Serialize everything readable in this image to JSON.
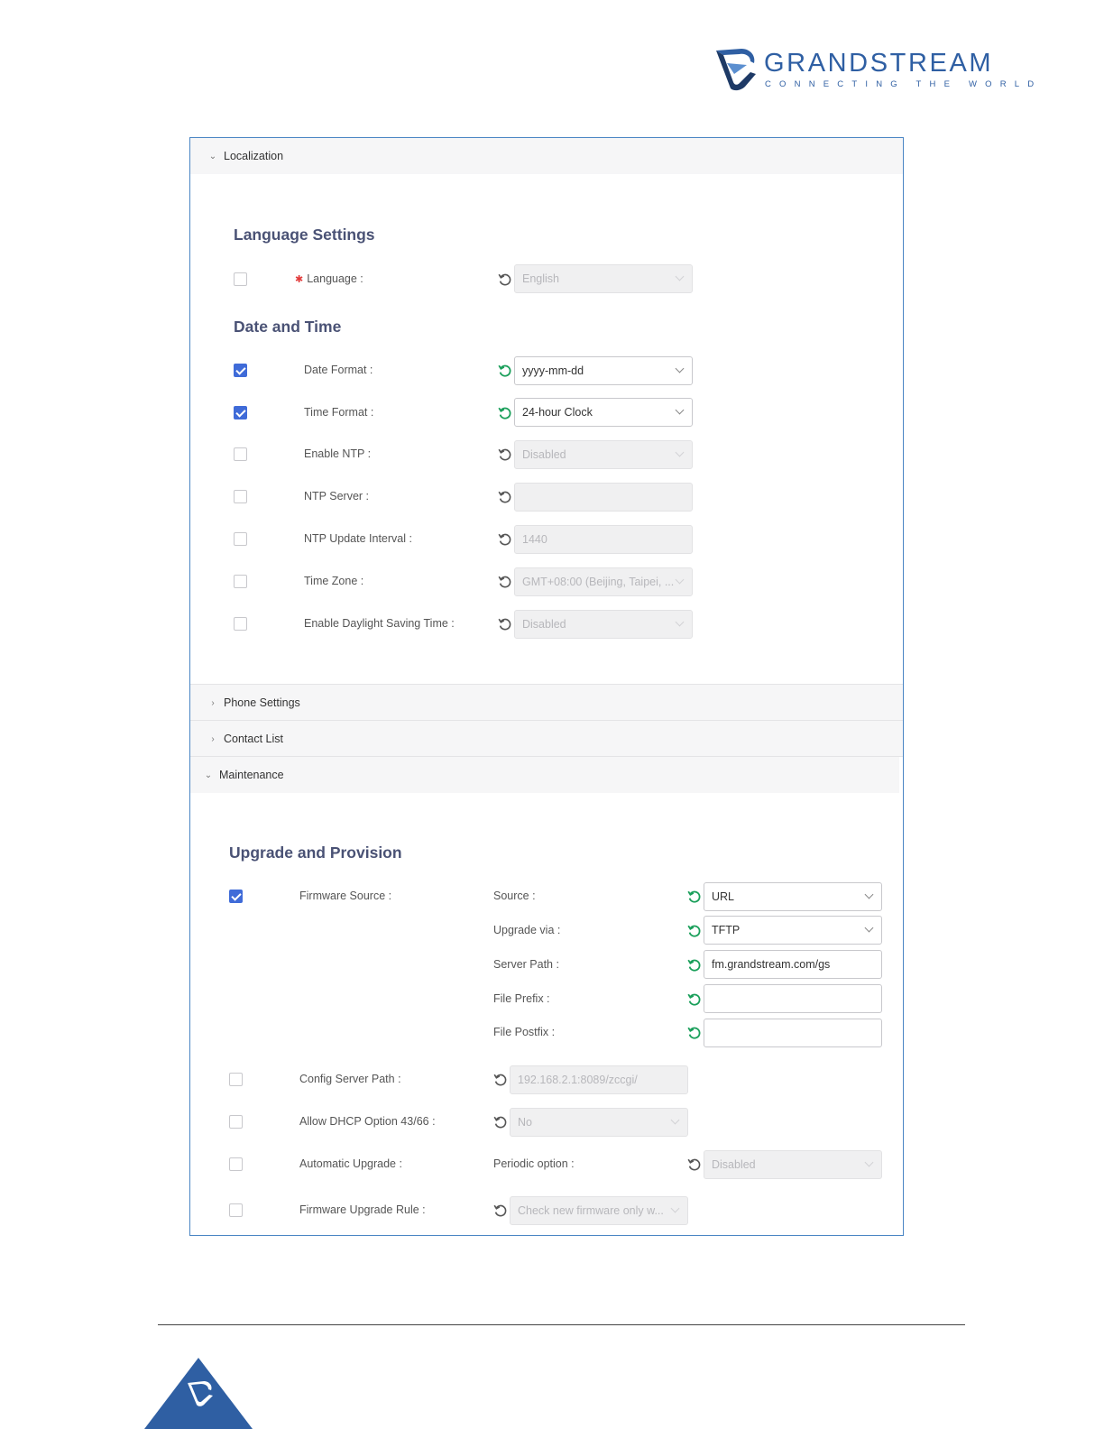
{
  "brand": {
    "name": "GRANDSTREAM",
    "tagline": "CONNECTING THE WORLD",
    "colors": {
      "primary": "#2f5fa3",
      "accent": "#3f6bd8",
      "reset_active": "#1a9f5a"
    }
  },
  "sections": {
    "localization": {
      "label": "Localization",
      "expanded": true
    },
    "phone_settings": {
      "label": "Phone Settings",
      "expanded": false
    },
    "contact_list": {
      "label": "Contact List",
      "expanded": false
    },
    "maintenance": {
      "label": "Maintenance",
      "expanded": true
    }
  },
  "language_settings": {
    "title": "Language Settings",
    "language": {
      "label": "Language :",
      "required": true,
      "checked": false,
      "value": "English"
    }
  },
  "date_time": {
    "title": "Date and Time",
    "date_format": {
      "label": "Date Format :",
      "checked": true,
      "value": "yyyy-mm-dd"
    },
    "time_format": {
      "label": "Time Format :",
      "checked": true,
      "value": "24-hour Clock"
    },
    "enable_ntp": {
      "label": "Enable NTP :",
      "checked": false,
      "value": "Disabled"
    },
    "ntp_server": {
      "label": "NTP Server :",
      "checked": false,
      "value": ""
    },
    "ntp_interval": {
      "label": "NTP Update Interval :",
      "checked": false,
      "value": "1440"
    },
    "time_zone": {
      "label": "Time Zone :",
      "checked": false,
      "value": "GMT+08:00 (Beijing, Taipei, ..."
    },
    "dst": {
      "label": "Enable Daylight Saving Time :",
      "checked": false,
      "value": "Disabled"
    }
  },
  "upgrade": {
    "title": "Upgrade and Provision",
    "firmware_source": {
      "label": "Firmware Source :",
      "checked": true,
      "source": {
        "label": "Source :",
        "value": "URL"
      },
      "upgrade_via": {
        "label": "Upgrade via :",
        "value": "TFTP"
      },
      "server_path": {
        "label": "Server Path :",
        "value": "fm.grandstream.com/gs"
      },
      "file_prefix": {
        "label": "File Prefix :",
        "value": ""
      },
      "file_postfix": {
        "label": "File Postfix :",
        "value": ""
      }
    },
    "config_server_path": {
      "label": "Config Server Path :",
      "checked": false,
      "value": "192.168.2.1:8089/zccgi/"
    },
    "dhcp_option": {
      "label": "Allow DHCP Option 43/66 :",
      "checked": false,
      "value": "No"
    },
    "auto_upgrade": {
      "label": "Automatic Upgrade :",
      "checked": false,
      "periodic_label": "Periodic option :",
      "value": "Disabled"
    },
    "firmware_rule": {
      "label": "Firmware Upgrade Rule :",
      "checked": false,
      "value": "Check new firmware only w..."
    }
  }
}
